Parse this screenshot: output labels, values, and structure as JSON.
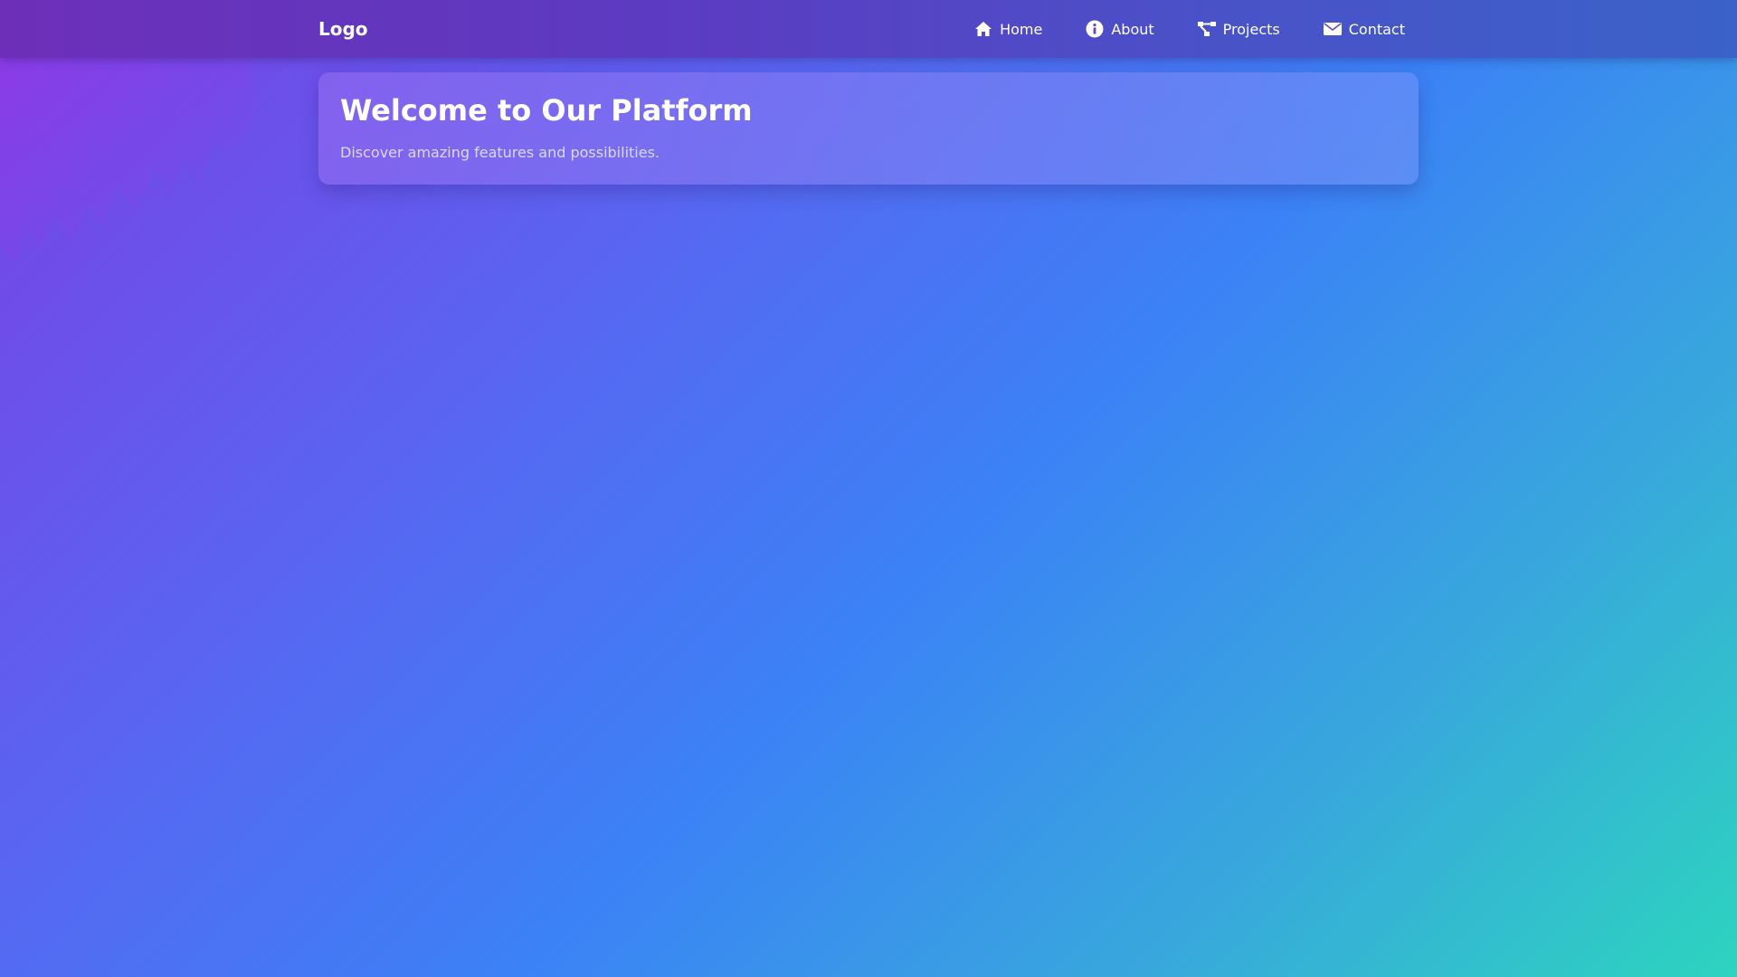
{
  "header": {
    "logo": "Logo",
    "nav": [
      {
        "label": "Home",
        "icon": "home-icon"
      },
      {
        "label": "About",
        "icon": "info-icon"
      },
      {
        "label": "Projects",
        "icon": "projects-icon"
      },
      {
        "label": "Contact",
        "icon": "envelope-icon"
      }
    ]
  },
  "hero": {
    "title": "Welcome to Our Platform",
    "subtitle": "Discover amazing features and possibilities."
  },
  "colors": {
    "gradient_start": "#7b3fe4",
    "gradient_mid": "#3b82f6",
    "gradient_end": "#2dd4bf",
    "text": "#ffffff"
  }
}
